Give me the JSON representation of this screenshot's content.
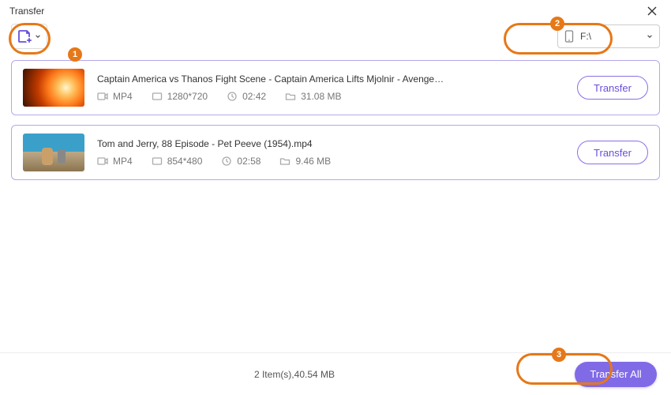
{
  "window": {
    "title": "Transfer"
  },
  "toolbar": {
    "add_tooltip": "Add file",
    "destination": {
      "label": "F:\\"
    }
  },
  "annotations": {
    "b1": "1",
    "b2": "2",
    "b3": "3"
  },
  "items": [
    {
      "name": "Captain America vs Thanos Fight Scene - Captain America Lifts Mjolnir - Avengers Endga...",
      "format": "MP4",
      "resolution": "1280*720",
      "duration": "02:42",
      "size": "31.08 MB",
      "transfer_label": "Transfer"
    },
    {
      "name": "Tom and Jerry, 88 Episode - Pet Peeve (1954).mp4",
      "format": "MP4",
      "resolution": "854*480",
      "duration": "02:58",
      "size": "9.46 MB",
      "transfer_label": "Transfer"
    }
  ],
  "footer": {
    "summary": "2 Item(s),40.54 MB",
    "transfer_all_label": "Transfer All"
  }
}
